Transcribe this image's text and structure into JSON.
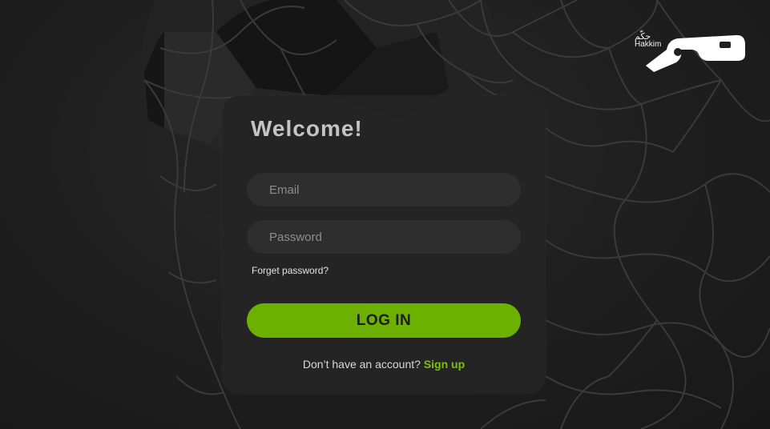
{
  "brand": {
    "logo_latin": "Hakkim",
    "logo_arabic": "حكّم",
    "logo_color": "#ffffff"
  },
  "background": {
    "theme": "dark",
    "motif": [
      "soccer-ball-icon",
      "goal-net"
    ]
  },
  "login_card": {
    "title": "Welcome!",
    "email_placeholder": "Email",
    "password_placeholder": "Password",
    "forget_password_label": "Forget password?",
    "login_button_label": "LOG IN",
    "no_account_text": "Don’t have an account?",
    "signup_label": "Sign up"
  },
  "colors": {
    "accent": "#6cb000",
    "link_accent": "#7dc10c",
    "card_bg": "#242424",
    "field_bg": "#2e2e2e",
    "page_bg": "#1f1f1f"
  }
}
